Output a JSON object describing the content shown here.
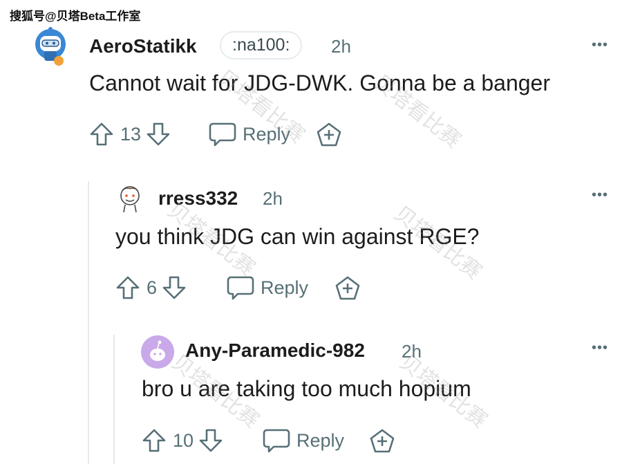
{
  "source_credit": "搜狐号@贝塔Beta工作室",
  "watermark_text": "贝塔看比赛",
  "comments": [
    {
      "username": "AeroStatikk",
      "flair": ":na100:",
      "time": "2h",
      "body": "Cannot wait for JDG-DWK. Gonna be a banger",
      "votes": "13",
      "reply_label": "Reply",
      "more_label": "•••"
    },
    {
      "username": "rress332",
      "time": "2h",
      "body": "you think JDG can win against RGE?",
      "votes": "6",
      "reply_label": "Reply",
      "more_label": "•••"
    },
    {
      "username": "Any-Paramedic-982",
      "time": "2h",
      "body": "bro u are taking too much hopium",
      "votes": "10",
      "reply_label": "Reply",
      "more_label": "•••"
    }
  ],
  "colors": {
    "text": "#1c1c1c",
    "meta": "#576f76",
    "thread_line": "#e6e8ea",
    "avatar_purple": "#c9a9e9"
  }
}
